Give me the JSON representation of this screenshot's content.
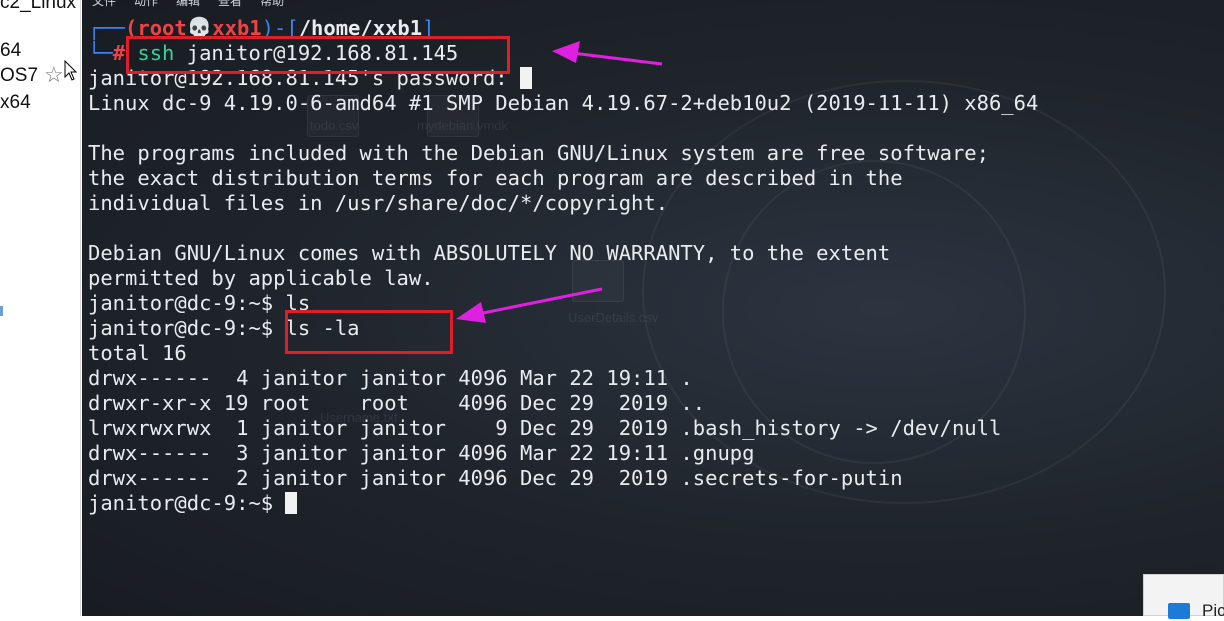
{
  "left_panel": {
    "items": [
      "c2_Linux",
      "64",
      "OS7",
      "x64"
    ]
  },
  "terminal": {
    "menubar": [
      "文件",
      "动作",
      "编辑",
      "查看",
      "帮助"
    ],
    "prompt": {
      "box_top": "┌──",
      "user": "(root",
      "skull": "💀",
      "host": "xxb1",
      "sep": ")-[",
      "dir": "/home/xxb1",
      "close": "]",
      "box_bottom": "└─",
      "hash": "#",
      "cmd_name": "ssh",
      "cmd_args": " janitor@192.168.81.145"
    },
    "lines": [
      "janitor@192.168.81.145's password: ",
      "Linux dc-9 4.19.0-6-amd64 #1 SMP Debian 4.19.67-2+deb10u2 (2019-11-11) x86_64",
      "",
      "The programs included with the Debian GNU/Linux system are free software;",
      "the exact distribution terms for each program are described in the",
      "individual files in /usr/share/doc/*/copyright.",
      "",
      "Debian GNU/Linux comes with ABSOLUTELY NO WARRANTY, to the extent",
      "permitted by applicable law.",
      "janitor@dc-9:~$ ls",
      "janitor@dc-9:~$ ls -la",
      "total 16",
      "drwx------  4 janitor janitor 4096 Mar 22 19:11 .",
      "drwxr-xr-x 19 root    root    4096 Dec 29  2019 ..",
      "lrwxrwxrwx  1 janitor janitor    9 Dec 29  2019 .bash_history -> /dev/null",
      "drwx------  3 janitor janitor 4096 Mar 22 19:11 .gnupg",
      "drwx------  2 janitor janitor 4096 Dec 29  2019 .secrets-for-putin",
      "janitor@dc-9:~$ "
    ]
  },
  "desktop_ghosts": [
    "todo.csv",
    "mydebian.vmdk",
    "UserDetails.csv",
    "Username.txt"
  ],
  "corner_popup": {
    "text": "Pic"
  },
  "colors": {
    "annotation_red": "#e11d2a",
    "arrow_magenta": "#e020e0",
    "prompt_blue": "#3b82f6",
    "prompt_red": "#ef4444",
    "ssh_green": "#34d399"
  }
}
